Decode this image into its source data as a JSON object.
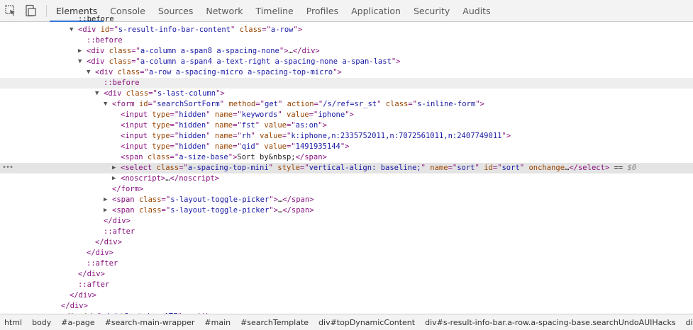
{
  "tabs": [
    "Elements",
    "Console",
    "Sources",
    "Network",
    "Timeline",
    "Profiles",
    "Application",
    "Security",
    "Audits"
  ],
  "active_tab": 0,
  "tree_lines": [
    {
      "indent": 110,
      "arrow": "",
      "selected": false,
      "hover": false,
      "dots": false,
      "segs": [
        [
          "x",
          "::before"
        ]
      ]
    },
    {
      "indent": 110,
      "arrow": "open",
      "selected": false,
      "hover": false,
      "dots": false,
      "segs": [
        [
          "t",
          "<div "
        ],
        [
          "a",
          "id"
        ],
        [
          "t",
          "=\""
        ],
        [
          "v",
          "s-result-info-bar-content"
        ],
        [
          "t",
          "\" "
        ],
        [
          "a",
          "class"
        ],
        [
          "t",
          "=\""
        ],
        [
          "v",
          "a-row"
        ],
        [
          "t",
          "\">"
        ]
      ]
    },
    {
      "indent": 122,
      "arrow": "",
      "selected": false,
      "hover": false,
      "dots": false,
      "segs": [
        [
          "p",
          "::before"
        ]
      ]
    },
    {
      "indent": 122,
      "arrow": "closed",
      "selected": false,
      "hover": false,
      "dots": false,
      "segs": [
        [
          "t",
          "<div "
        ],
        [
          "a",
          "class"
        ],
        [
          "t",
          "=\""
        ],
        [
          "v",
          "a-column a-span8 a-spacing-none"
        ],
        [
          "t",
          "\">"
        ],
        [
          "x",
          "…"
        ],
        [
          "t",
          "</div>"
        ]
      ]
    },
    {
      "indent": 122,
      "arrow": "open",
      "selected": false,
      "hover": false,
      "dots": false,
      "segs": [
        [
          "t",
          "<div "
        ],
        [
          "a",
          "class"
        ],
        [
          "t",
          "=\""
        ],
        [
          "v",
          "a-column a-span4 a-text-right a-spacing-none a-span-last"
        ],
        [
          "t",
          "\">"
        ]
      ]
    },
    {
      "indent": 134,
      "arrow": "open",
      "selected": false,
      "hover": false,
      "dots": false,
      "segs": [
        [
          "t",
          "<div "
        ],
        [
          "a",
          "class"
        ],
        [
          "t",
          "=\""
        ],
        [
          "v",
          "a-row a-spacing-micro a-spacing-top-micro"
        ],
        [
          "t",
          "\">"
        ]
      ]
    },
    {
      "indent": 146,
      "arrow": "",
      "selected": false,
      "hover": true,
      "dots": false,
      "segs": [
        [
          "p",
          "::before"
        ]
      ]
    },
    {
      "indent": 146,
      "arrow": "open",
      "selected": false,
      "hover": false,
      "dots": false,
      "segs": [
        [
          "t",
          "<div "
        ],
        [
          "a",
          "class"
        ],
        [
          "t",
          "=\""
        ],
        [
          "v",
          "s-last-column"
        ],
        [
          "t",
          "\">"
        ]
      ]
    },
    {
      "indent": 158,
      "arrow": "open",
      "selected": false,
      "hover": false,
      "dots": false,
      "segs": [
        [
          "t",
          "<form "
        ],
        [
          "a",
          "id"
        ],
        [
          "t",
          "=\""
        ],
        [
          "v",
          "searchSortForm"
        ],
        [
          "t",
          "\" "
        ],
        [
          "a",
          "method"
        ],
        [
          "t",
          "=\""
        ],
        [
          "v",
          "get"
        ],
        [
          "t",
          "\" "
        ],
        [
          "a",
          "action"
        ],
        [
          "t",
          "=\""
        ],
        [
          "v",
          "/s/ref=sr_st"
        ],
        [
          "t",
          "\" "
        ],
        [
          "a",
          "class"
        ],
        [
          "t",
          "=\""
        ],
        [
          "v",
          "s-inline-form"
        ],
        [
          "t",
          "\">"
        ]
      ]
    },
    {
      "indent": 170,
      "arrow": "",
      "selected": false,
      "hover": false,
      "dots": false,
      "segs": [
        [
          "t",
          "<input "
        ],
        [
          "a",
          "type"
        ],
        [
          "t",
          "=\""
        ],
        [
          "v",
          "hidden"
        ],
        [
          "t",
          "\" "
        ],
        [
          "a",
          "name"
        ],
        [
          "t",
          "=\""
        ],
        [
          "v",
          "keywords"
        ],
        [
          "t",
          "\" "
        ],
        [
          "a",
          "value"
        ],
        [
          "t",
          "=\""
        ],
        [
          "v",
          "iphone"
        ],
        [
          "t",
          "\">"
        ]
      ]
    },
    {
      "indent": 170,
      "arrow": "",
      "selected": false,
      "hover": false,
      "dots": false,
      "segs": [
        [
          "t",
          "<input "
        ],
        [
          "a",
          "type"
        ],
        [
          "t",
          "=\""
        ],
        [
          "v",
          "hidden"
        ],
        [
          "t",
          "\" "
        ],
        [
          "a",
          "name"
        ],
        [
          "t",
          "=\""
        ],
        [
          "v",
          "fst"
        ],
        [
          "t",
          "\" "
        ],
        [
          "a",
          "value"
        ],
        [
          "t",
          "=\""
        ],
        [
          "v",
          "as:on"
        ],
        [
          "t",
          "\">"
        ]
      ]
    },
    {
      "indent": 170,
      "arrow": "",
      "selected": false,
      "hover": false,
      "dots": false,
      "segs": [
        [
          "t",
          "<input "
        ],
        [
          "a",
          "type"
        ],
        [
          "t",
          "=\""
        ],
        [
          "v",
          "hidden"
        ],
        [
          "t",
          "\" "
        ],
        [
          "a",
          "name"
        ],
        [
          "t",
          "=\""
        ],
        [
          "v",
          "rh"
        ],
        [
          "t",
          "\" "
        ],
        [
          "a",
          "value"
        ],
        [
          "t",
          "=\""
        ],
        [
          "v",
          "k:iphone,n:2335752011,n:7072561011,n:2407749011"
        ],
        [
          "t",
          "\">"
        ]
      ]
    },
    {
      "indent": 170,
      "arrow": "",
      "selected": false,
      "hover": false,
      "dots": false,
      "segs": [
        [
          "t",
          "<input "
        ],
        [
          "a",
          "type"
        ],
        [
          "t",
          "=\""
        ],
        [
          "v",
          "hidden"
        ],
        [
          "t",
          "\" "
        ],
        [
          "a",
          "name"
        ],
        [
          "t",
          "=\""
        ],
        [
          "v",
          "qid"
        ],
        [
          "t",
          "\" "
        ],
        [
          "a",
          "value"
        ],
        [
          "t",
          "=\""
        ],
        [
          "v",
          "1491935144"
        ],
        [
          "t",
          "\">"
        ]
      ]
    },
    {
      "indent": 170,
      "arrow": "",
      "selected": false,
      "hover": false,
      "dots": false,
      "segs": [
        [
          "t",
          "<span "
        ],
        [
          "a",
          "class"
        ],
        [
          "t",
          "=\""
        ],
        [
          "v",
          "a-size-base"
        ],
        [
          "t",
          "\">"
        ],
        [
          "x",
          "Sort by&nbsp;"
        ],
        [
          "t",
          "</span>"
        ]
      ]
    },
    {
      "indent": 170,
      "arrow": "closed",
      "selected": true,
      "hover": false,
      "dots": true,
      "segs": [
        [
          "t",
          "<select "
        ],
        [
          "a",
          "class"
        ],
        [
          "t",
          "=\""
        ],
        [
          "v",
          "a-spacing-top-mini"
        ],
        [
          "t",
          "\" "
        ],
        [
          "a",
          "style"
        ],
        [
          "t",
          "=\""
        ],
        [
          "v",
          "vertical-align: baseline;"
        ],
        [
          "t",
          "\" "
        ],
        [
          "a",
          "name"
        ],
        [
          "t",
          "=\""
        ],
        [
          "v",
          "sort"
        ],
        [
          "t",
          "\" "
        ],
        [
          "a",
          "id"
        ],
        [
          "t",
          "=\""
        ],
        [
          "v",
          "sort"
        ],
        [
          "t",
          "\" "
        ],
        [
          "a",
          "onchange"
        ],
        [
          "x",
          "…"
        ],
        [
          "t",
          "</select>"
        ],
        [
          "x",
          " == "
        ],
        [
          "d",
          "$0"
        ]
      ]
    },
    {
      "indent": 170,
      "arrow": "closed",
      "selected": false,
      "hover": false,
      "dots": false,
      "segs": [
        [
          "t",
          "<noscript>"
        ],
        [
          "x",
          "…"
        ],
        [
          "t",
          "</noscript>"
        ]
      ]
    },
    {
      "indent": 158,
      "arrow": "",
      "selected": false,
      "hover": false,
      "dots": false,
      "segs": [
        [
          "t",
          "</form>"
        ]
      ]
    },
    {
      "indent": 158,
      "arrow": "closed",
      "selected": false,
      "hover": false,
      "dots": false,
      "segs": [
        [
          "t",
          "<span "
        ],
        [
          "a",
          "class"
        ],
        [
          "t",
          "=\""
        ],
        [
          "v",
          "s-layout-toggle-picker"
        ],
        [
          "t",
          "\">"
        ],
        [
          "x",
          "…"
        ],
        [
          "t",
          "</span>"
        ]
      ]
    },
    {
      "indent": 158,
      "arrow": "closed",
      "selected": false,
      "hover": false,
      "dots": false,
      "segs": [
        [
          "t",
          "<span "
        ],
        [
          "a",
          "class"
        ],
        [
          "t",
          "=\""
        ],
        [
          "v",
          "s-layout-toggle-picker"
        ],
        [
          "t",
          "\">"
        ],
        [
          "x",
          "…"
        ],
        [
          "t",
          "</span>"
        ]
      ]
    },
    {
      "indent": 146,
      "arrow": "",
      "selected": false,
      "hover": false,
      "dots": false,
      "segs": [
        [
          "t",
          "</div>"
        ]
      ]
    },
    {
      "indent": 146,
      "arrow": "",
      "selected": false,
      "hover": false,
      "dots": false,
      "segs": [
        [
          "p",
          "::after"
        ]
      ]
    },
    {
      "indent": 134,
      "arrow": "",
      "selected": false,
      "hover": false,
      "dots": false,
      "segs": [
        [
          "t",
          "</div>"
        ]
      ]
    },
    {
      "indent": 122,
      "arrow": "",
      "selected": false,
      "hover": false,
      "dots": false,
      "segs": [
        [
          "t",
          "</div>"
        ]
      ]
    },
    {
      "indent": 122,
      "arrow": "",
      "selected": false,
      "hover": false,
      "dots": false,
      "segs": [
        [
          "p",
          "::after"
        ]
      ]
    },
    {
      "indent": 110,
      "arrow": "",
      "selected": false,
      "hover": false,
      "dots": false,
      "segs": [
        [
          "t",
          "</div>"
        ]
      ]
    },
    {
      "indent": 110,
      "arrow": "",
      "selected": false,
      "hover": false,
      "dots": false,
      "segs": [
        [
          "p",
          "::after"
        ]
      ]
    },
    {
      "indent": 98,
      "arrow": "",
      "selected": false,
      "hover": false,
      "dots": false,
      "segs": [
        [
          "t",
          "</div>"
        ]
      ]
    },
    {
      "indent": 86,
      "arrow": "",
      "selected": false,
      "hover": false,
      "dots": false,
      "segs": [
        [
          "t",
          "</div>"
        ]
      ]
    },
    {
      "indent": 86,
      "arrow": "closed",
      "selected": false,
      "hover": false,
      "dots": false,
      "segs": [
        [
          "t",
          "<div "
        ],
        [
          "a",
          "id"
        ],
        [
          "t",
          "=\""
        ],
        [
          "v",
          "rightContainerATF"
        ],
        [
          "t",
          "\">"
        ],
        [
          "x",
          "…"
        ],
        [
          "t",
          "</div>"
        ]
      ]
    }
  ],
  "breadcrumbs": [
    "html",
    "body",
    "#a-page",
    "#search-main-wrapper",
    "#main",
    "#searchTemplate",
    "div#topDynamicContent",
    "div#s-result-info-bar.a-row.a-spacing-base.searchUndoAUIHacks",
    "div#s-result-info-bar-co"
  ],
  "colors": {
    "tag": "#881280",
    "attr_name": "#994500",
    "attr_value": "#1a1aa6",
    "selection": "#e4e4e4",
    "accent": "#3879d9"
  },
  "icons": [
    "inspect-element-icon",
    "device-toolbar-icon",
    "expand-arrow-icon",
    "collapse-arrow-icon"
  ]
}
